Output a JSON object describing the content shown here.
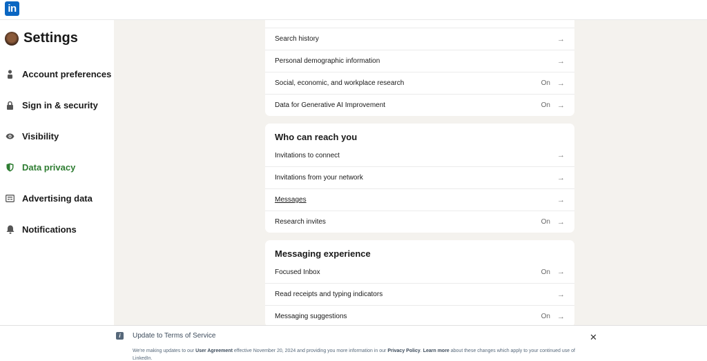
{
  "header": {
    "logo_text": "in"
  },
  "sidebar": {
    "title": "Settings",
    "items": [
      {
        "label": "Account preferences",
        "icon": "person-icon",
        "active": false
      },
      {
        "label": "Sign in & security",
        "icon": "lock-icon",
        "active": false
      },
      {
        "label": "Visibility",
        "icon": "eye-icon",
        "active": false
      },
      {
        "label": "Data privacy",
        "icon": "shield-icon",
        "active": true
      },
      {
        "label": "Advertising data",
        "icon": "ad-card-icon",
        "active": false
      },
      {
        "label": "Notifications",
        "icon": "bell-icon",
        "active": false
      }
    ]
  },
  "colors": {
    "brand": "#0a66c2",
    "active_nav": "#2e7d32",
    "background": "#f4f2ee"
  },
  "sections": [
    {
      "title": "",
      "rows": [
        {
          "label": "Search history",
          "status": ""
        },
        {
          "label": "Personal demographic information",
          "status": ""
        },
        {
          "label": "Social, economic, and workplace research",
          "status": "On"
        },
        {
          "label": "Data for Generative AI Improvement",
          "status": "On"
        }
      ]
    },
    {
      "title": "Who can reach you",
      "rows": [
        {
          "label": "Invitations to connect",
          "status": ""
        },
        {
          "label": "Invitations from your network",
          "status": ""
        },
        {
          "label": "Messages",
          "status": ""
        },
        {
          "label": "Research invites",
          "status": "On"
        }
      ]
    },
    {
      "title": "Messaging experience",
      "rows": [
        {
          "label": "Focused Inbox",
          "status": "On"
        },
        {
          "label": "Read receipts and typing indicators",
          "status": ""
        },
        {
          "label": "Messaging suggestions",
          "status": "On"
        }
      ]
    }
  ],
  "arrow_glyph": "→",
  "banner": {
    "title": "Update to Terms of Service",
    "text_1": "We're making updates to our ",
    "link_1": "User Agreement",
    "text_2": " effective November 20, 2024 and providing you more information in our ",
    "link_2": "Privacy Policy",
    "text_3": ". ",
    "link_3": "Learn more",
    "text_4": " about these changes which apply to your continued use of LinkedIn.",
    "close": "✕"
  }
}
